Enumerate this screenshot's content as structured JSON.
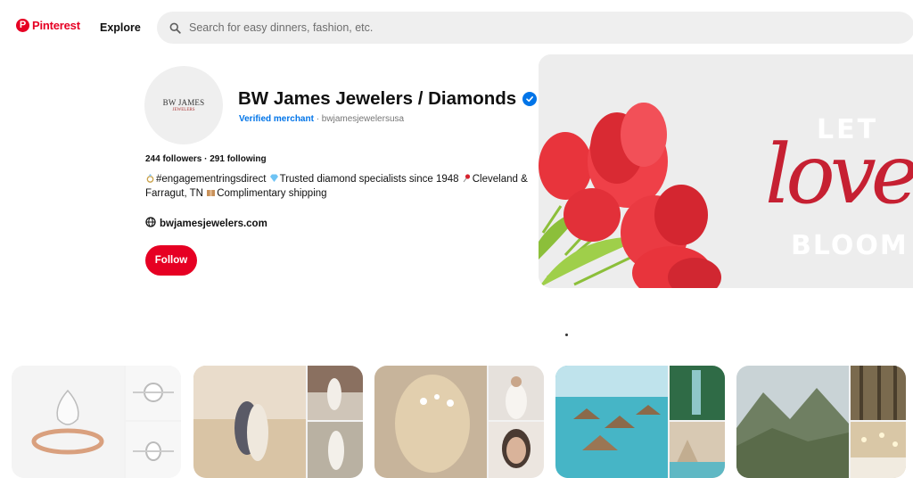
{
  "header": {
    "logo_text": "Pinterest",
    "logo_mark": "P",
    "explore_label": "Explore",
    "search_placeholder": "Search for easy dinners, fashion, etc.",
    "search_icon": "search-icon"
  },
  "profile": {
    "avatar_text": "BW JAMES",
    "avatar_sub": "JEWELERS",
    "name": "BW James Jewelers / Diamonds",
    "verified_icon": "verified-check-icon",
    "merchant_label": "Verified merchant",
    "handle": " · bwjamesjewelersusa",
    "stats": "244 followers · 291 following",
    "bio_line1": "#engagementringsdirect",
    "bio_line2": "Trusted diamond specialists since 1948",
    "bio_line3": "Cleveland & Farragut, TN",
    "bio_line4": "Complimentary shipping",
    "website": "bwjamesjewelers.com",
    "follow_label": "Follow"
  },
  "cover": {
    "line1": "LET",
    "line2": "love",
    "line3": "BLOOM"
  },
  "colors": {
    "brand": "#e60023",
    "verified": "#0074e8",
    "search_bg": "#efefef"
  }
}
